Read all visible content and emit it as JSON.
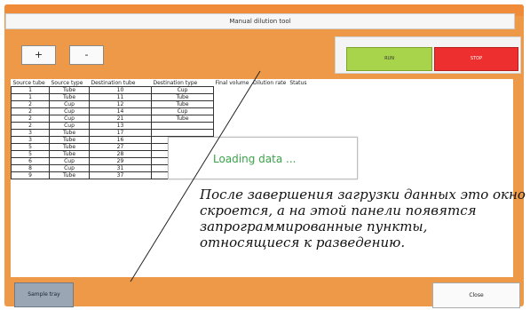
{
  "window": {
    "title": "Manual dilution tool"
  },
  "toolbar": {
    "plus_label": "+",
    "minus_label": "-",
    "run_label": "RUN",
    "stop_label": "STOP"
  },
  "table": {
    "headers": [
      "Source tube",
      "Source type",
      "Destination tube",
      "Destination type",
      "Final volume",
      "Dilution rate",
      "Status"
    ],
    "rows": [
      [
        "1",
        "Tube",
        "10",
        "Cup"
      ],
      [
        "1",
        "Tube",
        "11",
        "Tube"
      ],
      [
        "2",
        "Cup",
        "12",
        "Tube"
      ],
      [
        "2",
        "Cup",
        "14",
        "Cup"
      ],
      [
        "2",
        "Cup",
        "21",
        "Tube"
      ],
      [
        "2",
        "Cup",
        "13",
        ""
      ],
      [
        "3",
        "Tube",
        "17",
        ""
      ],
      [
        "3",
        "Tube",
        "16",
        ""
      ],
      [
        "5",
        "Tube",
        "27",
        ""
      ],
      [
        "5",
        "Tube",
        "28",
        ""
      ],
      [
        "6",
        "Cup",
        "29",
        ""
      ],
      [
        "8",
        "Cup",
        "31",
        ""
      ],
      [
        "9",
        "Tube",
        "37",
        ""
      ]
    ]
  },
  "overlay": {
    "loading_text": "Loading data ..."
  },
  "annotation": {
    "text": "После завершения загрузки данных это окно скроется, а на этой панели появятся запрограммированные пункты, относящиеся к разведению."
  },
  "footer": {
    "sample_tray_label": "Sample tray",
    "close_label": "Close"
  },
  "colors": {
    "background": "#ee9947",
    "run": "#a8d44c",
    "stop": "#ee2f2f",
    "loading_text": "#3aa348"
  }
}
